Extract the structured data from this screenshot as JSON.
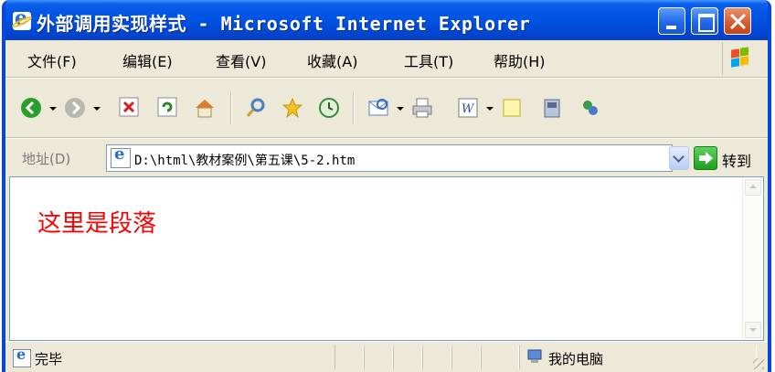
{
  "window": {
    "title": "外部调用实现样式 - Microsoft Internet Explorer"
  },
  "menu": {
    "items": [
      "文件(F)",
      "编辑(E)",
      "查看(V)",
      "收藏(A)",
      "工具(T)",
      "帮助(H)"
    ]
  },
  "toolbar": {
    "icons": [
      "back-icon",
      "forward-icon",
      "stop-icon",
      "refresh-icon",
      "home-icon",
      "search-icon",
      "favorites-icon",
      "history-icon",
      "mail-icon",
      "print-icon",
      "edit-icon",
      "discuss-icon",
      "messenger-icon",
      "research-icon"
    ]
  },
  "address": {
    "label": "地址(D)",
    "url": "D:\\html\\教材案例\\第五课\\5-2.htm",
    "go_label": "转到"
  },
  "content": {
    "paragraph": "这里是段落",
    "paragraph_color": "#ff0000"
  },
  "status": {
    "text": "完毕",
    "zone": "我的电脑"
  },
  "colors": {
    "titlebar": "#0054e3",
    "window_frame": "#0a46d8",
    "chrome": "#ece9d8"
  }
}
